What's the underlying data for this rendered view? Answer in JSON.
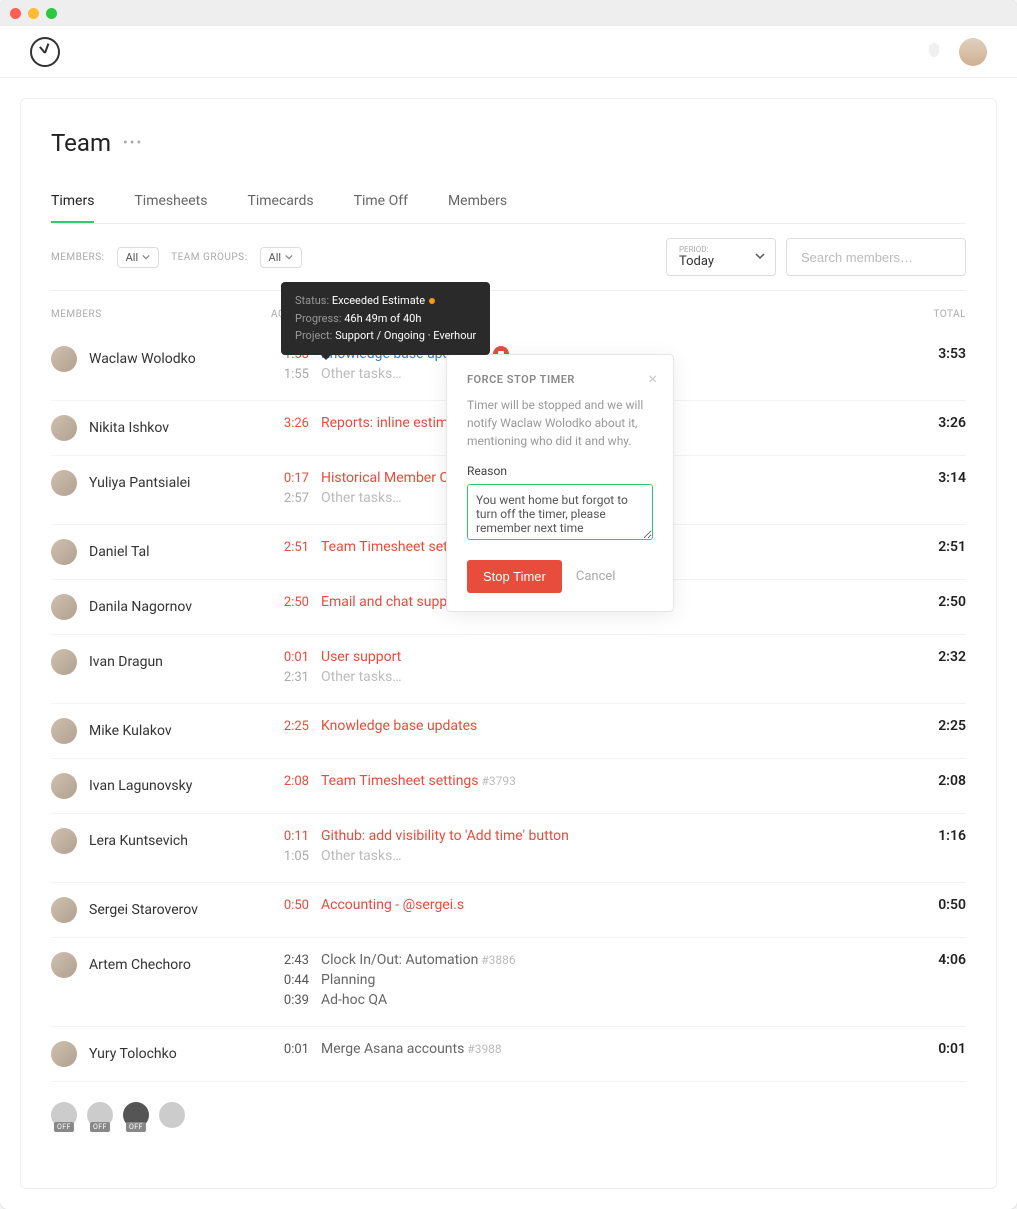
{
  "page": {
    "title": "Team"
  },
  "tabs": [
    "Timers",
    "Timesheets",
    "Timecards",
    "Time Off",
    "Members"
  ],
  "filters": {
    "members_label": "MEMBERS:",
    "members_value": "All",
    "groups_label": "TEAM GROUPS:",
    "groups_value": "All",
    "period_label": "PERIOD:",
    "period_value": "Today",
    "search_placeholder": "Search members…"
  },
  "columns": {
    "members": "MEMBERS",
    "activity": "ACTIVITY",
    "total": "TOTAL"
  },
  "tooltip": {
    "status_label": "Status:",
    "status_value": "Exceeded Estimate",
    "progress_label": "Progress:",
    "progress_value": "46h 49m of 40h",
    "project_label": "Project:",
    "project_value": "Support / Ongoing · Everhour"
  },
  "modal": {
    "title": "FORCE STOP TIMER",
    "description": "Timer will be stopped and we will notify Waclaw Wolodko about it, mentioning who did it and why.",
    "reason_label": "Reason",
    "reason_value": "You went home but forgot to turn off the timer, please remember next time",
    "stop_btn": "Stop Timer",
    "cancel_btn": "Cancel"
  },
  "members": [
    {
      "name": "Waclaw Wolodko",
      "total": "3:53",
      "activities": [
        {
          "time": "1:58",
          "task": "Knowledge base updates",
          "style": "current",
          "stop": true
        },
        {
          "time": "1:55",
          "task": "Other tasks…",
          "style": "secondary"
        }
      ]
    },
    {
      "name": "Nikita Ishkov",
      "total": "3:26",
      "activities": [
        {
          "time": "3:26",
          "task": "Reports: inline estimate",
          "style": "active"
        }
      ]
    },
    {
      "name": "Yuliya Pantsialei",
      "total": "3:14",
      "activities": [
        {
          "time": "0:17",
          "task": "Historical Member Cost",
          "style": "active"
        },
        {
          "time": "2:57",
          "task": "Other tasks…",
          "style": "secondary"
        }
      ]
    },
    {
      "name": "Daniel Tal",
      "total": "2:51",
      "activities": [
        {
          "time": "2:51",
          "task": "Team Timesheet setting",
          "style": "active"
        }
      ]
    },
    {
      "name": "Danila Nagornov",
      "total": "2:50",
      "activities": [
        {
          "time": "2:50",
          "task": "Email and chat support",
          "style": "active"
        }
      ]
    },
    {
      "name": "Ivan Dragun",
      "total": "2:32",
      "activities": [
        {
          "time": "0:01",
          "task": "User support",
          "style": "active"
        },
        {
          "time": "2:31",
          "task": "Other tasks…",
          "style": "secondary"
        }
      ]
    },
    {
      "name": "Mike Kulakov",
      "total": "2:25",
      "activities": [
        {
          "time": "2:25",
          "task": "Knowledge base updates",
          "style": "active"
        }
      ]
    },
    {
      "name": "Ivan Lagunovsky",
      "total": "2:08",
      "activities": [
        {
          "time": "2:08",
          "task": "Team Timesheet settings",
          "tag": "#3793",
          "style": "active"
        }
      ]
    },
    {
      "name": "Lera Kuntsevich",
      "total": "1:16",
      "activities": [
        {
          "time": "0:11",
          "task": "Github: add visibility to 'Add time' button",
          "style": "active"
        },
        {
          "time": "1:05",
          "task": "Other tasks…",
          "style": "secondary"
        }
      ]
    },
    {
      "name": "Sergei Staroverov",
      "total": "0:50",
      "activities": [
        {
          "time": "0:50",
          "task": "Accounting - @sergei.s",
          "style": "active"
        }
      ]
    },
    {
      "name": "Artem Chechoro",
      "total": "4:06",
      "activities": [
        {
          "time": "2:43",
          "task": "Clock In/Out: Automation",
          "tag": "#3886",
          "style": "normal"
        },
        {
          "time": "0:44",
          "task": "Planning",
          "style": "normal"
        },
        {
          "time": "0:39",
          "task": "Ad-hoc QA",
          "style": "normal"
        }
      ]
    },
    {
      "name": "Yury Tolochko",
      "total": "0:01",
      "activities": [
        {
          "time": "0:01",
          "task": "Merge Asana accounts",
          "tag": "#3988",
          "style": "normal"
        }
      ]
    }
  ],
  "off_badge": "OFF"
}
